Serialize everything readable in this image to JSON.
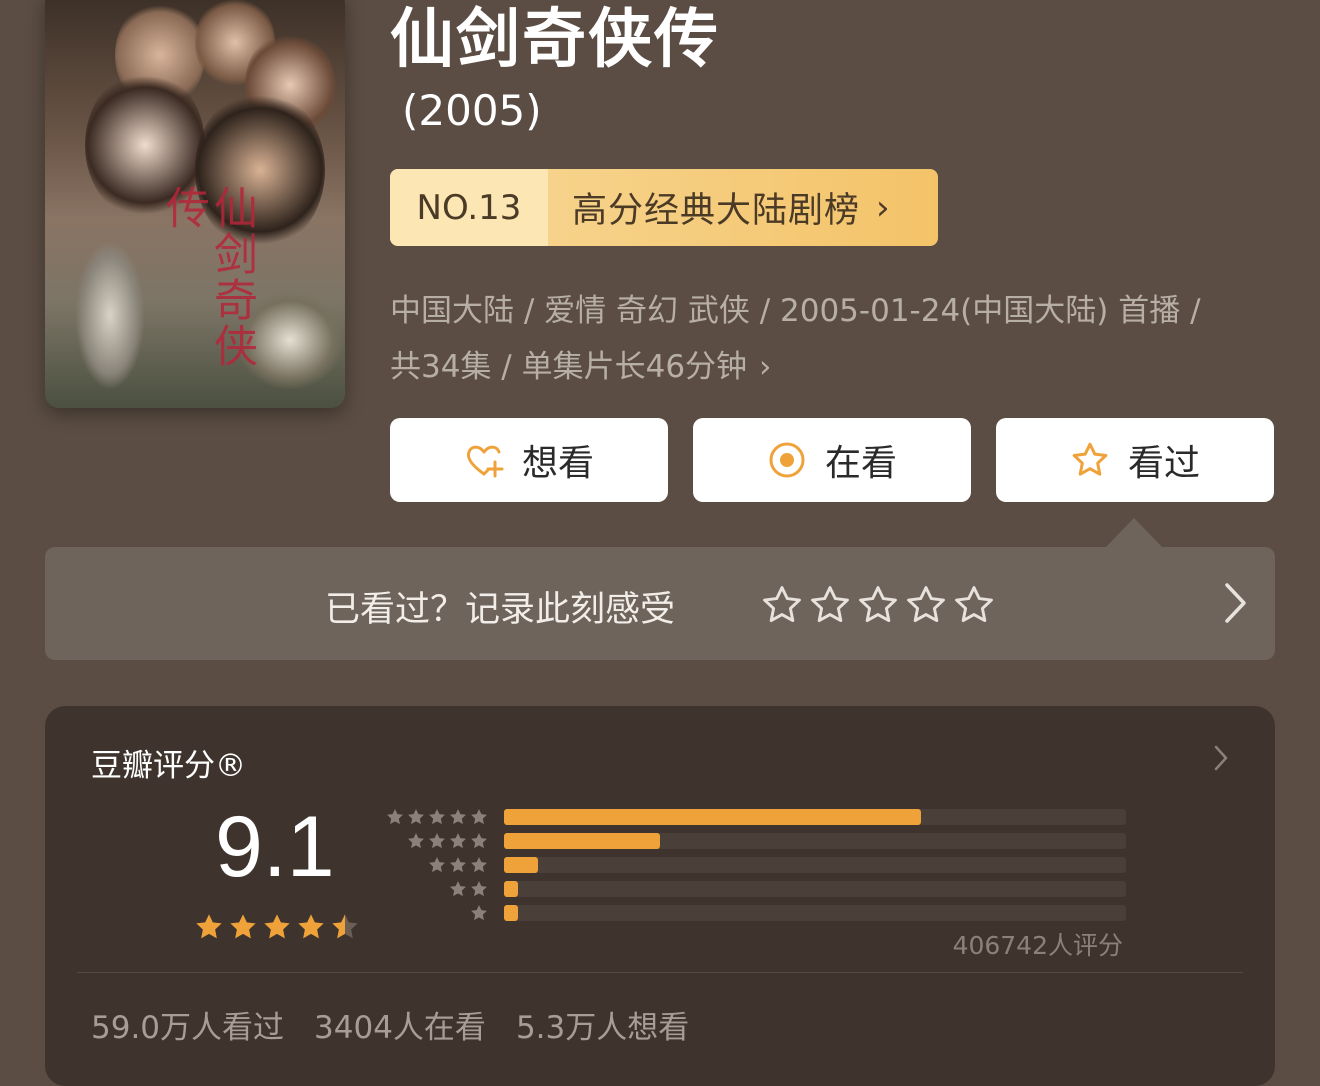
{
  "title": "仙剑奇侠传",
  "year": "(2005)",
  "ranking": {
    "number": "NO.13",
    "list_name": "高分经典大陆剧榜",
    "chevron": "›"
  },
  "meta": {
    "line1": "中国大陆 / 爱情 奇幻 武侠 / 2005-01-24(中国大陆) 首播 /",
    "line2": "共34集 / 单集片长46分钟",
    "arrow": "›"
  },
  "poster": {
    "title_text": "仙剑奇侠传"
  },
  "actions": [
    {
      "label": "想看",
      "icon": "heart-plus-icon"
    },
    {
      "label": "在看",
      "icon": "target-icon"
    },
    {
      "label": "看过",
      "icon": "star-outline-icon"
    }
  ],
  "rate_prompt": {
    "text": "已看过？记录此刻感受",
    "stars_count": 5
  },
  "douban_rating": {
    "title": "豆瓣评分®",
    "score": "9.1",
    "stars": 4.5,
    "distribution": [
      {
        "stars": 5,
        "fraction": 0.67
      },
      {
        "stars": 4,
        "fraction": 0.25
      },
      {
        "stars": 3,
        "fraction": 0.055
      },
      {
        "stars": 2,
        "fraction": 0.02
      },
      {
        "stars": 1,
        "fraction": 0.02
      }
    ],
    "votes": "406742人评分",
    "stats": {
      "watched": "59.0万人看过",
      "watching": "3404人在看",
      "want": "5.3万人想看"
    }
  },
  "colors": {
    "accent": "#f0a23a",
    "background": "#5b4d43",
    "card": "#3e342d",
    "rank_gold": "#f4c369"
  }
}
